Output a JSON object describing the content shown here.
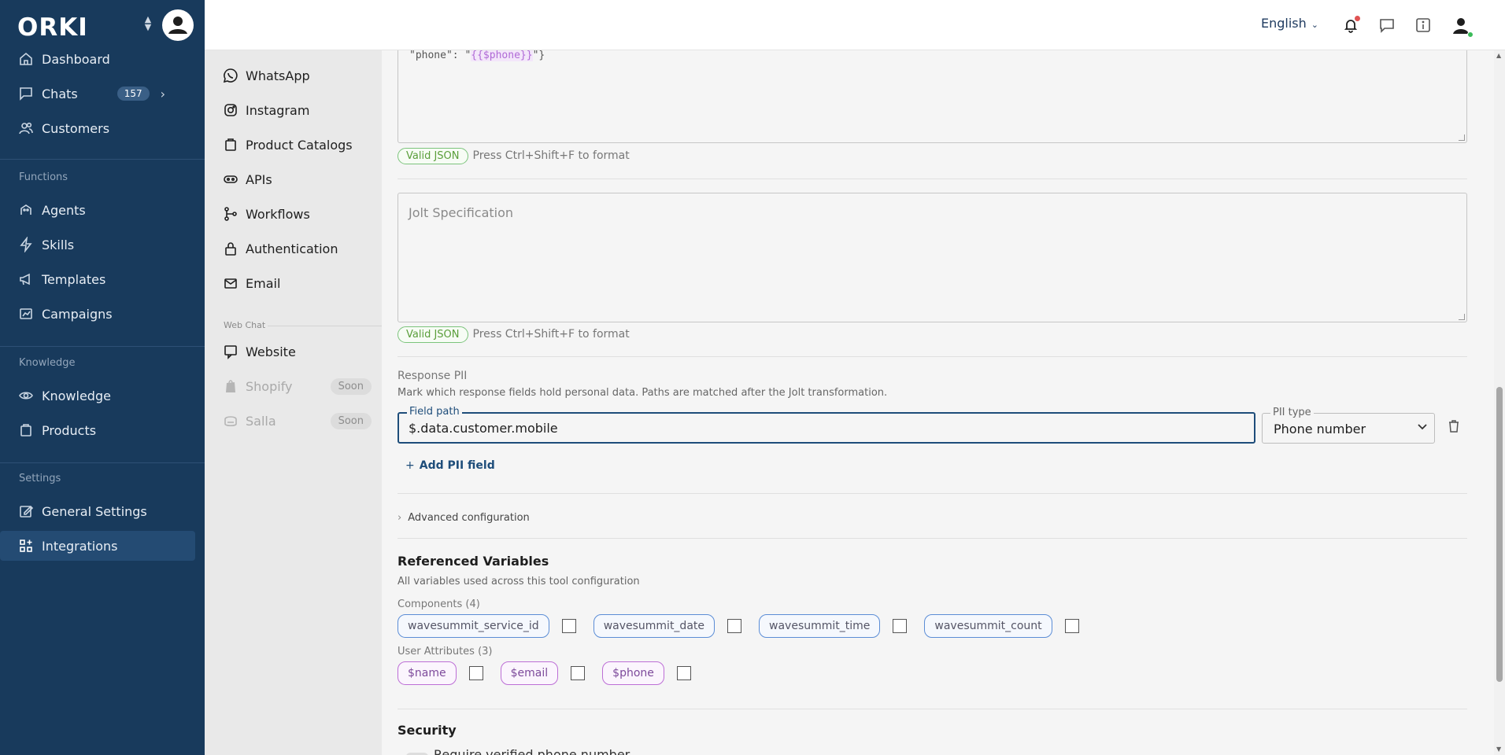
{
  "brand": {
    "logo": "ORKI"
  },
  "nav": {
    "dashboard": "Dashboard",
    "chats": "Chats",
    "chats_count": "157",
    "customers": "Customers",
    "functions_label": "Functions",
    "agents": "Agents",
    "skills": "Skills",
    "templates": "Templates",
    "campaigns": "Campaigns",
    "knowledge_label": "Knowledge",
    "knowledge": "Knowledge",
    "products": "Products",
    "settings_label": "Settings",
    "general_settings": "General Settings",
    "integrations": "Integrations"
  },
  "subnav": {
    "whatsapp": "WhatsApp",
    "instagram": "Instagram",
    "product_catalogs": "Product Catalogs",
    "apis": "APIs",
    "workflows": "Workflows",
    "authentication": "Authentication",
    "email": "Email",
    "webchat_label": "Web Chat",
    "website": "Website",
    "shopify": "Shopify",
    "salla": "Salla",
    "soon": "Soon"
  },
  "header": {
    "language": "English"
  },
  "editor": {
    "code_snippet_prefix": "\"phone\": \"",
    "code_snippet_var": "{{$phone}}",
    "code_snippet_suffix": "\"}",
    "valid_json": "Valid JSON",
    "format_hint": "Press Ctrl+Shift+F to format",
    "jolt_placeholder": "Jolt Specification"
  },
  "pii": {
    "section_label": "Response PII",
    "description": "Mark which response fields hold personal data. Paths are matched after the Jolt transformation.",
    "field_path_label": "Field path",
    "field_path_value": "$.data.customer.mobile",
    "pii_type_label": "PII type",
    "pii_type_value": "Phone number",
    "add_button": "Add PII field"
  },
  "advanced": {
    "label": "Advanced configuration"
  },
  "variables": {
    "title": "Referenced Variables",
    "description": "All variables used across this tool configuration",
    "components_label": "Components (4)",
    "components": [
      "wavesummit_service_id",
      "wavesummit_date",
      "wavesummit_time",
      "wavesummit_count"
    ],
    "user_attrs_label": "User Attributes (3)",
    "user_attrs": [
      "$name",
      "$email",
      "$phone"
    ]
  },
  "security": {
    "title": "Security",
    "require_verified": "Require verified phone number"
  }
}
